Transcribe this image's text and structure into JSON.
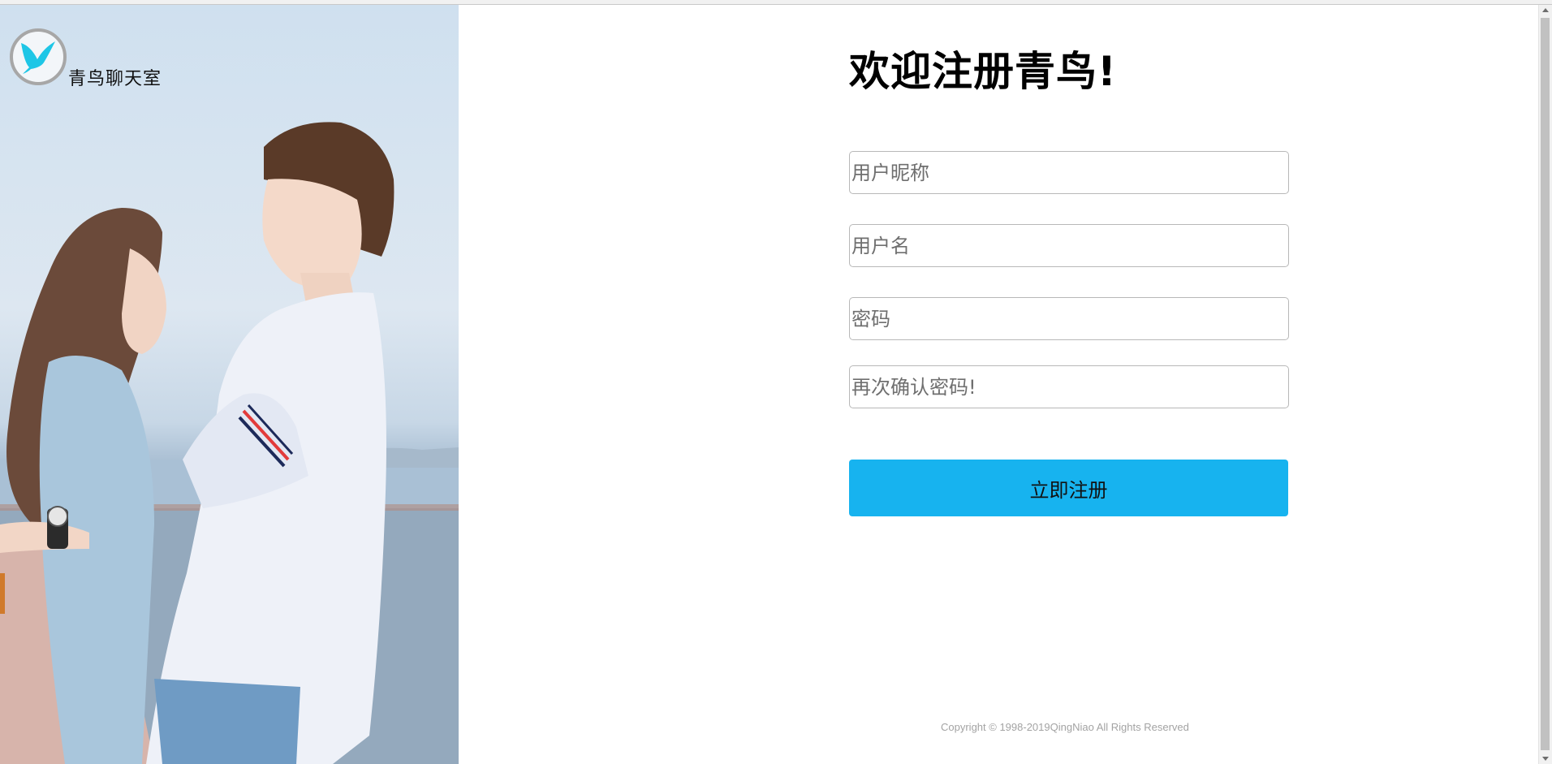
{
  "brand": {
    "name": "青鸟聊天室"
  },
  "form": {
    "title": "欢迎注册青鸟!",
    "nickname_placeholder": "用户昵称",
    "username_placeholder": "用户名",
    "password_placeholder": "密码",
    "confirm_password_placeholder": "再次确认密码!",
    "submit_label": "立即注册"
  },
  "footer": {
    "copyright": "Copyright © 1998-2019QingNiao All Rights Reserved"
  },
  "colors": {
    "accent": "#17b3ef",
    "logo_bird": "#1ec6e6"
  },
  "icons": {
    "logo": "bird-icon"
  }
}
